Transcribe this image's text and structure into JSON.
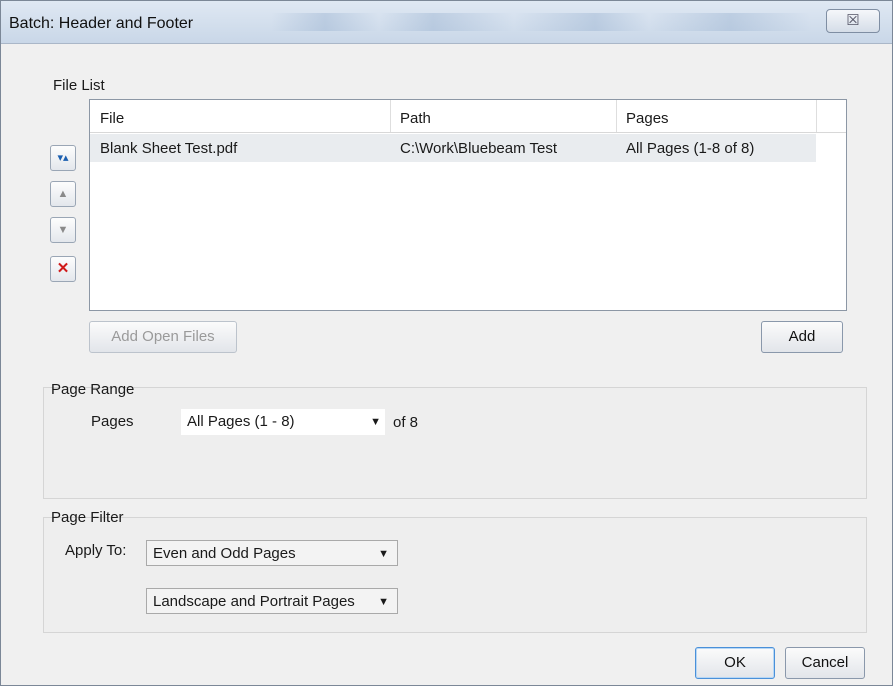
{
  "window": {
    "title": "Batch: Header and Footer",
    "close_glyph": "☒"
  },
  "file_list": {
    "label": "File List",
    "columns": [
      "File",
      "Path",
      "Pages"
    ],
    "rows": [
      {
        "file": "Blank Sheet Test.pdf",
        "path": "C:\\Work\\Bluebeam Test",
        "pages": "All Pages (1-8 of 8)"
      }
    ],
    "add_open_files": "Add Open Files",
    "add": "Add",
    "side_buttons": {
      "top": "▾▴",
      "up": "▲",
      "down": "▼",
      "remove": "✕"
    }
  },
  "page_range": {
    "label": "Page Range",
    "pages_label": "Pages",
    "pages_value": "All Pages (1 - 8)",
    "of_text": "of 8"
  },
  "page_filter": {
    "label": "Page Filter",
    "apply_to_label": "Apply To:",
    "parity_value": "Even and Odd Pages",
    "orientation_value": "Landscape and Portrait Pages"
  },
  "footer": {
    "ok": "OK",
    "cancel": "Cancel"
  }
}
